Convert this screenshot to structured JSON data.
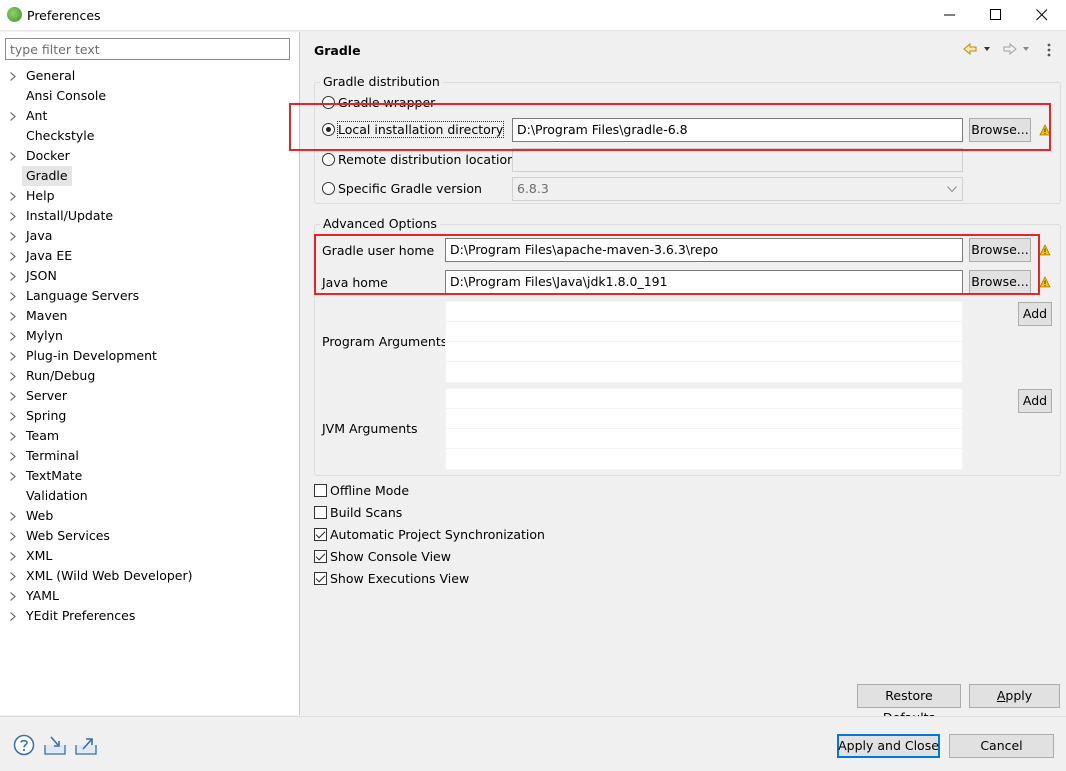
{
  "window": {
    "title": "Preferences"
  },
  "sidebar": {
    "filter_placeholder": "type filter text",
    "items": [
      {
        "label": "General",
        "expandable": true
      },
      {
        "label": "Ansi Console",
        "expandable": false
      },
      {
        "label": "Ant",
        "expandable": true
      },
      {
        "label": "Checkstyle",
        "expandable": false
      },
      {
        "label": "Docker",
        "expandable": true
      },
      {
        "label": "Gradle",
        "expandable": false,
        "selected": true
      },
      {
        "label": "Help",
        "expandable": true
      },
      {
        "label": "Install/Update",
        "expandable": true
      },
      {
        "label": "Java",
        "expandable": true
      },
      {
        "label": "Java EE",
        "expandable": true
      },
      {
        "label": "JSON",
        "expandable": true
      },
      {
        "label": "Language Servers",
        "expandable": true
      },
      {
        "label": "Maven",
        "expandable": true
      },
      {
        "label": "Mylyn",
        "expandable": true
      },
      {
        "label": "Plug-in Development",
        "expandable": true
      },
      {
        "label": "Run/Debug",
        "expandable": true
      },
      {
        "label": "Server",
        "expandable": true
      },
      {
        "label": "Spring",
        "expandable": true
      },
      {
        "label": "Team",
        "expandable": true
      },
      {
        "label": "Terminal",
        "expandable": true
      },
      {
        "label": "TextMate",
        "expandable": true
      },
      {
        "label": "Validation",
        "expandable": false
      },
      {
        "label": "Web",
        "expandable": true
      },
      {
        "label": "Web Services",
        "expandable": true
      },
      {
        "label": "XML",
        "expandable": true
      },
      {
        "label": "XML (Wild Web Developer)",
        "expandable": true
      },
      {
        "label": "YAML",
        "expandable": true
      },
      {
        "label": "YEdit Preferences",
        "expandable": true
      }
    ]
  },
  "page": {
    "title": "Gradle"
  },
  "distribution": {
    "group_label": "Gradle distribution",
    "wrapper_label": "Gradle wrapper",
    "local_label": "Local installation directory",
    "local_value": "D:\\Program Files\\gradle-6.8",
    "remote_label": "Remote distribution location",
    "remote_value": "",
    "specific_label": "Specific Gradle version",
    "specific_value": "6.8.3",
    "browse_label": "Browse..."
  },
  "advanced": {
    "group_label": "Advanced Options",
    "user_home_label": "Gradle user home",
    "user_home_value": "D:\\Program Files\\apache-maven-3.6.3\\repo",
    "java_home_label": "Java home",
    "java_home_value": "D:\\Program Files\\Java\\jdk1.8.0_191",
    "browse_label": "Browse...",
    "program_args_label": "Program Arguments",
    "jvm_args_label": "JVM Arguments",
    "add_label": "Add"
  },
  "options": {
    "offline_mode": {
      "label": "Offline Mode",
      "checked": false
    },
    "build_scans": {
      "label": "Build Scans",
      "checked": false
    },
    "auto_sync": {
      "label": "Automatic Project Synchronization",
      "checked": true
    },
    "show_console": {
      "label": "Show Console View",
      "checked": true
    },
    "show_executions": {
      "label": "Show Executions View",
      "checked": true
    }
  },
  "page_buttons": {
    "restore_defaults": "Restore Defaults",
    "apply": "Apply"
  },
  "dialog_buttons": {
    "apply_and_close": "Apply and Close",
    "cancel": "Cancel"
  },
  "colors": {
    "highlight_box": "#e8242a",
    "default_button_border": "#0078d7",
    "warning": "#f2c200"
  }
}
